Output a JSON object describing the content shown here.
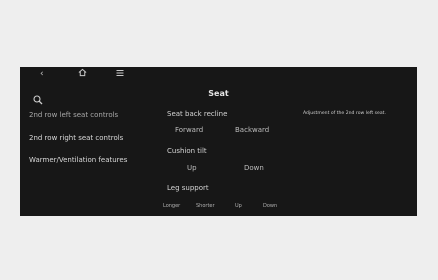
{
  "header": {
    "back_icon": "back-chevron-icon",
    "home_icon": "home-icon",
    "menu_icon": "menu-icon",
    "title": "Seat"
  },
  "sidebar": {
    "search_icon": "search-icon",
    "items": [
      {
        "label": "2nd row left seat controls",
        "state": "selected"
      },
      {
        "label": "2nd row right seat controls"
      },
      {
        "label": "Warmer/Ventilation features"
      }
    ]
  },
  "main": {
    "seat_back_recline": {
      "label": "Seat back recline",
      "options": [
        "Forward",
        "Backward"
      ]
    },
    "cushion_tilt": {
      "label": "Cushion tilt",
      "options": [
        "Up",
        "Down"
      ]
    },
    "leg_support": {
      "label": "Leg support",
      "options": [
        "Longer",
        "Shorter",
        "Up",
        "Down"
      ]
    }
  },
  "description": "Adjustment of the 2nd row left seat.",
  "colors": {
    "page_background": "#eeeeee",
    "screen_background": "#171717",
    "text_primary": "#dadada",
    "text_selected": "#a9a9a9"
  }
}
